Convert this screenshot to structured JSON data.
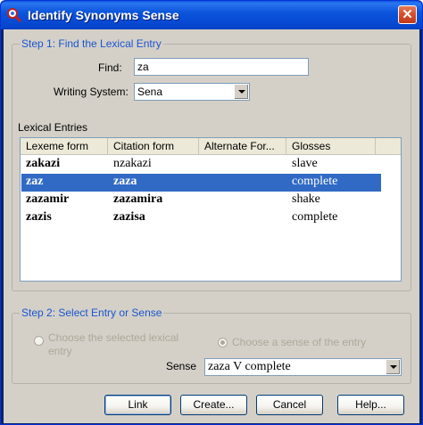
{
  "window": {
    "title": "Identify Synonyms Sense",
    "icon": "synonyms-app-icon",
    "close_label": "✕",
    "accent": "#0a5be0"
  },
  "step1": {
    "legend": "Step 1: Find the Lexical Entry",
    "find_label": "Find:",
    "find_value": "za",
    "writing_system_label": "Writing System:",
    "writing_system_value": "Sena"
  },
  "lexical_entries": {
    "label": "Lexical Entries",
    "columns": [
      "Lexeme form",
      "Citation form",
      "Alternate For...",
      "Glosses"
    ],
    "rows": [
      {
        "lexeme": "zakazi",
        "citation": "nzakazi",
        "alternate": "",
        "gloss": "slave",
        "selected": false
      },
      {
        "lexeme": "zaz",
        "citation": "zaza",
        "alternate": "",
        "gloss": "complete",
        "selected": true
      },
      {
        "lexeme": "zazamir",
        "citation": "zazamira",
        "alternate": "",
        "gloss": "shake",
        "selected": false
      },
      {
        "lexeme": "zazis",
        "citation": "zazisa",
        "alternate": "",
        "gloss": "complete",
        "selected": false
      }
    ],
    "selection_color": "#316ac5"
  },
  "step2": {
    "legend": "Step 2: Select Entry or Sense",
    "radio_entry_line1": "Choose the selected lexical",
    "radio_entry_line2": "entry",
    "radio_sense": "Choose a sense of the entry",
    "sense_label": "Sense",
    "sense_value": "zaza V complete"
  },
  "buttons": {
    "link": "Link",
    "create": "Create...",
    "cancel": "Cancel",
    "help": "Help..."
  }
}
